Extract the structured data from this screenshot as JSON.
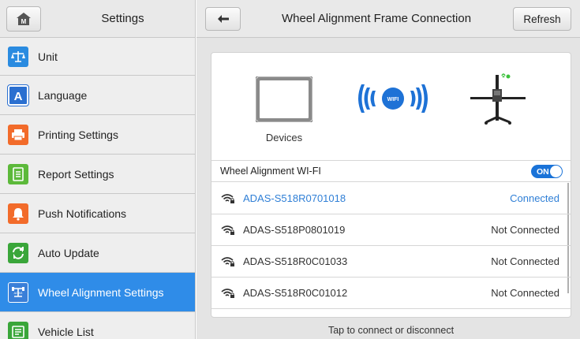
{
  "sidebar": {
    "title": "Settings",
    "items": [
      {
        "label": "Unit",
        "icon": "scale-icon",
        "color": "#2a8be0",
        "active": false
      },
      {
        "label": "Language",
        "icon": "language-icon",
        "color": "#2a6fd0",
        "active": false
      },
      {
        "label": "Printing Settings",
        "icon": "printer-icon",
        "color": "#f26b2a",
        "active": false
      },
      {
        "label": "Report Settings",
        "icon": "report-icon",
        "color": "#5cb93a",
        "active": false
      },
      {
        "label": "Push Notifications",
        "icon": "bell-icon",
        "color": "#f26b2a",
        "active": false
      },
      {
        "label": "Auto Update",
        "icon": "update-icon",
        "color": "#3aa63a",
        "active": false
      },
      {
        "label": "Wheel Alignment Settings",
        "icon": "adas-icon",
        "color": "#3a7fd8",
        "active": true
      },
      {
        "label": "Vehicle List",
        "icon": "vehicle-list-icon",
        "color": "#3aa63a",
        "active": false
      }
    ]
  },
  "header": {
    "title": "Wheel Alignment Frame Connection",
    "refresh_label": "Refresh"
  },
  "diagram": {
    "devices_label": "Devices",
    "wifi_badge": "WIFI"
  },
  "wifi": {
    "label": "Wheel Alignment WI-FI",
    "toggle": "ON"
  },
  "networks": [
    {
      "name": "ADAS-S518R0701018",
      "status": "Connected",
      "connected": true
    },
    {
      "name": "ADAS-S518P0801019",
      "status": "Not Connected",
      "connected": false
    },
    {
      "name": "ADAS-S518R0C01033",
      "status": "Not Connected",
      "connected": false
    },
    {
      "name": "ADAS-S518R0C01012",
      "status": "Not Connected",
      "connected": false
    }
  ],
  "hint": "Tap to connect or disconnect",
  "colors": {
    "accent": "#2f8ce8",
    "connected": "#2f7fd6",
    "toggle": "#1a73d8"
  }
}
